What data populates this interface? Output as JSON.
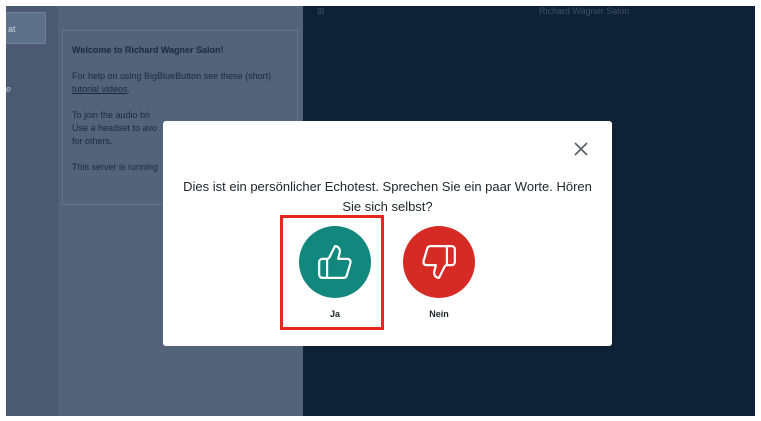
{
  "left_rail": {
    "active_item_label": "at",
    "secondary_label": "e"
  },
  "chat": {
    "welcome": "Welcome to Richard Wagner Salon!",
    "help_prefix": "For help on using BigBlueButton see these (short) ",
    "help_link": "tutorial videos",
    "help_suffix": ".",
    "audio_line1": "To join the audio bri",
    "audio_line2": "Use a headset to avo",
    "audio_line3": "for others.",
    "server_line": "This server is running"
  },
  "topbar": {
    "glyph": "⊞",
    "title": "Richard Wagner Salon"
  },
  "modal": {
    "prompt": "Dies ist ein persönlicher Echotest. Sprechen Sie ein paar Worte. Hören Sie sich selbst?",
    "yes_label": "Ja",
    "no_label": "Nein",
    "yes_color": "#12877d",
    "no_color": "#d62a24",
    "highlight_color": "#e8251f"
  }
}
